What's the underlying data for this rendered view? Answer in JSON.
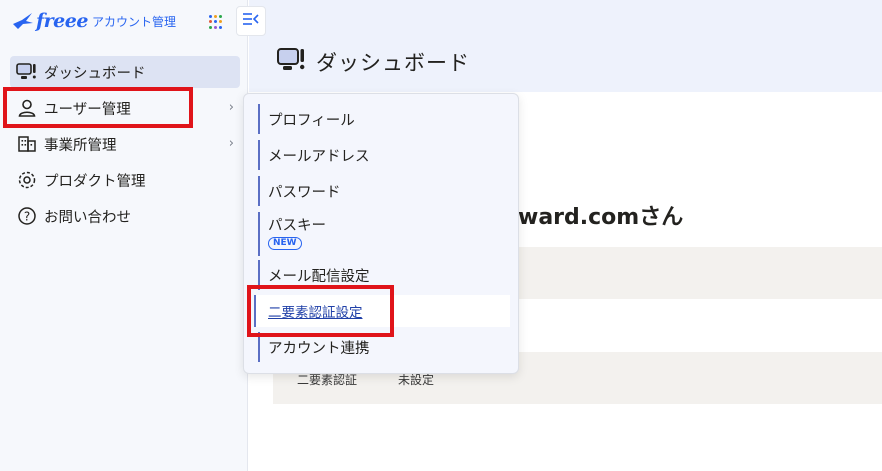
{
  "app": {
    "brand": "freee",
    "product_name": "アカウント管理",
    "colors": {
      "brand": "#2864f0",
      "highlight": "#e0141a",
      "active_bg": "#dde3f3"
    }
  },
  "sidebar": {
    "apps_icon": "apps-grid-icon",
    "collapse_icon": "collapse-sidebar-icon",
    "items": [
      {
        "label": "ダッシュボード",
        "icon": "dashboard-icon",
        "active": true
      },
      {
        "label": "ユーザー管理",
        "icon": "user-icon",
        "chevron": "›"
      },
      {
        "label": "事業所管理",
        "icon": "building-icon",
        "chevron": "›"
      },
      {
        "label": "プロダクト管理",
        "icon": "product-gear-icon"
      },
      {
        "label": "お問い合わせ",
        "icon": "question-icon"
      }
    ]
  },
  "submenu": {
    "items": [
      {
        "label": "プロフィール"
      },
      {
        "label": "メールアドレス"
      },
      {
        "label": "パスワード"
      },
      {
        "label": "パスキー",
        "badge": "NEW"
      },
      {
        "label": "メール配信設定"
      },
      {
        "label": "二要素認証設定",
        "hover": true
      },
      {
        "label": "アカウント連携"
      }
    ]
  },
  "main": {
    "title": "ダッシュボード",
    "greeting_partial": "ward.comさん",
    "tfa_row": {
      "label": "二要素認証",
      "value": "未設定"
    }
  }
}
